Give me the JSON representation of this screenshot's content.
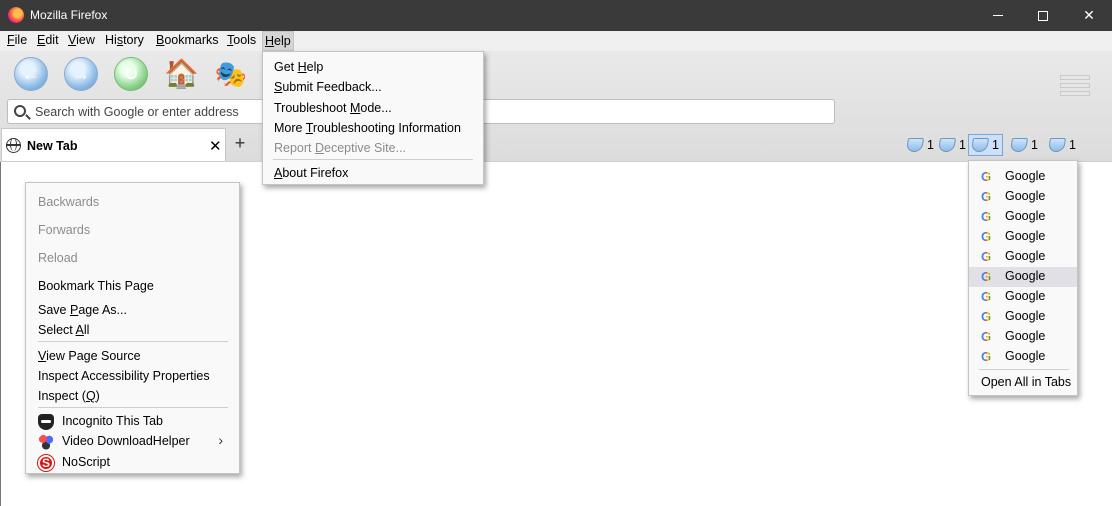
{
  "window": {
    "title": "Mozilla Firefox",
    "controls": {
      "minimize": "—",
      "maximize": "□",
      "close": "✕"
    }
  },
  "menubar": {
    "file": {
      "u": "F",
      "rest": "ile"
    },
    "edit": {
      "u": "E",
      "rest": "dit"
    },
    "view": {
      "u": "V",
      "rest": "iew"
    },
    "history": {
      "pre": "Hi",
      "u": "s",
      "rest": "tory"
    },
    "bookmarks": {
      "u": "B",
      "rest": "ookmarks"
    },
    "tools": {
      "u": "T",
      "rest": "ools"
    },
    "help": {
      "u": "H",
      "rest": "elp"
    }
  },
  "toolbar": {
    "back_icon": "←",
    "forward_icon": "→",
    "reload_icon": "↻",
    "home_icon": "🏠",
    "mask_icon": "🎭"
  },
  "urlbar": {
    "placeholder": "Search with Google or enter address"
  },
  "tab": {
    "label": "New Tab",
    "close": "✕",
    "new_tab": "+"
  },
  "bookmark_folders": [
    {
      "count": "1"
    },
    {
      "count": "1"
    },
    {
      "count": "1"
    },
    {
      "count": "1"
    },
    {
      "count": "1"
    }
  ],
  "help_menu": {
    "get_help": {
      "pre": "Get ",
      "u": "H",
      "rest": "elp"
    },
    "submit_feedback": {
      "u": "S",
      "rest": "ubmit Feedback..."
    },
    "troubleshoot": {
      "pre": "Troubleshoot ",
      "u": "M",
      "rest": "ode..."
    },
    "more_troubleshooting": {
      "pre": "More ",
      "u": "T",
      "rest": "roubleshooting Information"
    },
    "report": {
      "pre": "Report ",
      "u": "D",
      "rest": "eceptive Site..."
    },
    "about": {
      "u": "A",
      "rest": "bout Firefox"
    }
  },
  "context_menu": {
    "back": "Backwards",
    "forward": "Forwards",
    "reload": "Reload",
    "bookmark": "Bookmark This Page",
    "save": {
      "pre": "Save ",
      "u": "P",
      "rest": "age As..."
    },
    "select_all": {
      "pre": "Select ",
      "u": "A",
      "rest": "ll"
    },
    "view_source": {
      "u": "V",
      "rest": "iew Page Source"
    },
    "inspect_a11y": "Inspect Accessibility Properties",
    "inspect": {
      "pre": "Inspect (",
      "u": "Q",
      "rest": ")"
    },
    "incognito": "Incognito This Tab",
    "vdh": "Video DownloadHelper",
    "noscript": "NoScript",
    "chevron": "›"
  },
  "bookmark_menu": {
    "items": [
      "Google",
      "Google",
      "Google",
      "Google",
      "Google",
      "Google",
      "Google",
      "Google",
      "Google",
      "Google"
    ],
    "icon_letter": "G",
    "open_all": "Open All in Tabs"
  }
}
